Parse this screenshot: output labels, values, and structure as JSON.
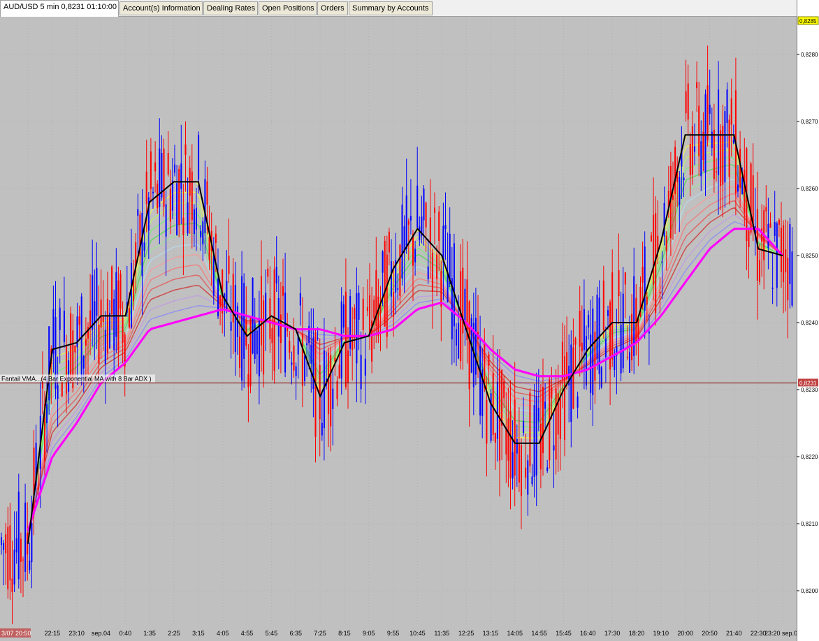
{
  "tabs": [
    {
      "label": "AUD/USD 5 min 0,8231 01:10:00",
      "active": true
    },
    {
      "label": "Account(s) Information"
    },
    {
      "label": "Dealing Rates"
    },
    {
      "label": "Open Positions"
    },
    {
      "label": "Orders"
    },
    {
      "label": "Summary by Accounts"
    }
  ],
  "indicator_label": "Fantail VMA...(4 Bar Exponential MA with 8 Bar ADX )",
  "current_price": "0,8231",
  "top_price": "0,8285",
  "price_ticks": [
    "0,8280",
    "0,8270",
    "0,8260",
    "0,8250",
    "0,8240",
    "0,8230",
    "0,8220",
    "0,8210",
    "0,8200"
  ],
  "time_ticks": [
    "3/07 20:50",
    "22:15",
    "23:10",
    "sep.04",
    "0:40",
    "1:35",
    "2:25",
    "3:15",
    "4:05",
    "4:55",
    "5:45",
    "6:35",
    "7:25",
    "8:15",
    "9:05",
    "9:55",
    "10:45",
    "11:35",
    "12:25",
    "13:15",
    "14:05",
    "14:55",
    "15:45",
    "16:40",
    "17:30",
    "18:20",
    "19:10",
    "20:00",
    "20:50",
    "21:40",
    "22:30",
    "23:20 sep.05"
  ],
  "colors": {
    "chart_bg": "#c0c0c0",
    "up_candle": "#0000ff",
    "down_candle": "#ff0000",
    "price_line": "#800000",
    "vma_line": "#000000",
    "zigzag": "#00e5ff",
    "slow_ma": "#ff00ff",
    "current_badge": "#c04040",
    "top_badge": "#ffff00"
  },
  "chart_data": {
    "type": "line",
    "instrument": "AUD/USD",
    "timeframe": "5 min",
    "ylim": [
      0.8195,
      0.8285
    ],
    "grid": true,
    "x": [
      "3/07 20:50",
      "22:15",
      "23:10",
      "sep.04",
      "0:40",
      "1:35",
      "2:25",
      "3:15",
      "4:05",
      "4:55",
      "5:45",
      "6:35",
      "7:25",
      "8:15",
      "9:05",
      "9:55",
      "10:45",
      "11:35",
      "12:25",
      "13:15",
      "14:05",
      "14:55",
      "15:45",
      "16:40",
      "17:30",
      "18:20",
      "19:10",
      "20:00",
      "20:50",
      "21:40",
      "22:30",
      "23:20 sep.05"
    ],
    "series": [
      {
        "name": "Fantail VMA...(4 Bar Exponential MA with 8 Bar ADX )",
        "values": [
          0.8207,
          0.8236,
          0.8237,
          0.8241,
          0.8241,
          0.8258,
          0.8261,
          0.8261,
          0.8244,
          0.8238,
          0.8241,
          0.8239,
          0.8229,
          0.8237,
          0.8238,
          0.8248,
          0.8254,
          0.825,
          0.8239,
          0.8228,
          0.8222,
          0.8222,
          0.823,
          0.8236,
          0.824,
          0.824,
          0.8252,
          0.8268,
          0.8268,
          0.8268,
          0.8251,
          0.825
        ]
      },
      {
        "values": [
          0.8209,
          0.822,
          0.8225,
          0.8231,
          0.8234,
          0.8239,
          0.824,
          0.8241,
          0.8242,
          0.8241,
          0.824,
          0.8239,
          0.8239,
          0.8238,
          0.8238,
          0.8239,
          0.8242,
          0.8243,
          0.824,
          0.8236,
          0.8233,
          0.8232,
          0.8232,
          0.8233,
          0.8235,
          0.8237,
          0.8241,
          0.8246,
          0.8251,
          0.8254,
          0.8254,
          0.825
        ]
      }
    ]
  }
}
